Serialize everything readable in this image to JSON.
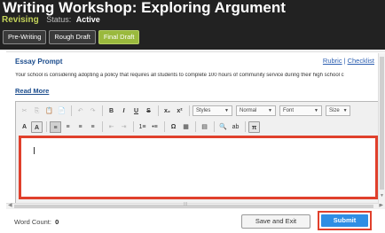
{
  "header": {
    "title": "Writing Workshop: Exploring Argument",
    "phase": "Revising",
    "status_label": "Status:",
    "status_value": "Active",
    "steps": [
      {
        "label": "Pre-Writing",
        "active": false
      },
      {
        "label": "Rough Draft",
        "active": false
      },
      {
        "label": "Final Draft",
        "active": true
      }
    ]
  },
  "prompt": {
    "heading": "Essay Prompt",
    "links": {
      "rubric": "Rubric",
      "separator": "|",
      "checklist": "Checklist"
    },
    "text": "Your school is considering adopting a policy that requires all students to complete 100 hours of community service during their high school c",
    "read_more": "Read More"
  },
  "toolbar": {
    "row1": {
      "cut": "✂",
      "copy": "⎘",
      "paste": "📋",
      "paste_text": "📄",
      "undo": "↶",
      "redo": "↷",
      "bold": "B",
      "italic": "I",
      "underline": "U",
      "strike": "S",
      "subscript": "x₂",
      "superscript": "x²",
      "styles": "Styles",
      "format": "Normal",
      "font": "Font",
      "size": "Size"
    },
    "row2": {
      "text_color": "A",
      "bg_color": "A",
      "align_left": "≡",
      "align_center": "≡",
      "align_right": "≡",
      "justify": "≡",
      "outdent": "⇤",
      "indent": "⇥",
      "ordered_list": "1≡",
      "bulleted_list": "•≡",
      "special_char": "Ω",
      "table": "▦",
      "source": "▤",
      "find": "🔍",
      "replace": "ab",
      "math": "π"
    },
    "icons": {
      "cut": "scissors-icon",
      "copy": "copy-icon",
      "paste": "paste-icon",
      "find": "magnifier-icon",
      "math": "pi-icon"
    }
  },
  "editor": {
    "content": ""
  },
  "footer": {
    "word_count_label": "Word Count:",
    "word_count_value": "0",
    "save_exit_label": "Save and Exit",
    "submit_label": "Submit"
  },
  "colors": {
    "header_bg": "#222222",
    "phase": "#c3d35a",
    "active_step": "#9ab93d",
    "link": "#2a5db0",
    "highlight": "#e0402c",
    "submit": "#2f8ee4"
  }
}
